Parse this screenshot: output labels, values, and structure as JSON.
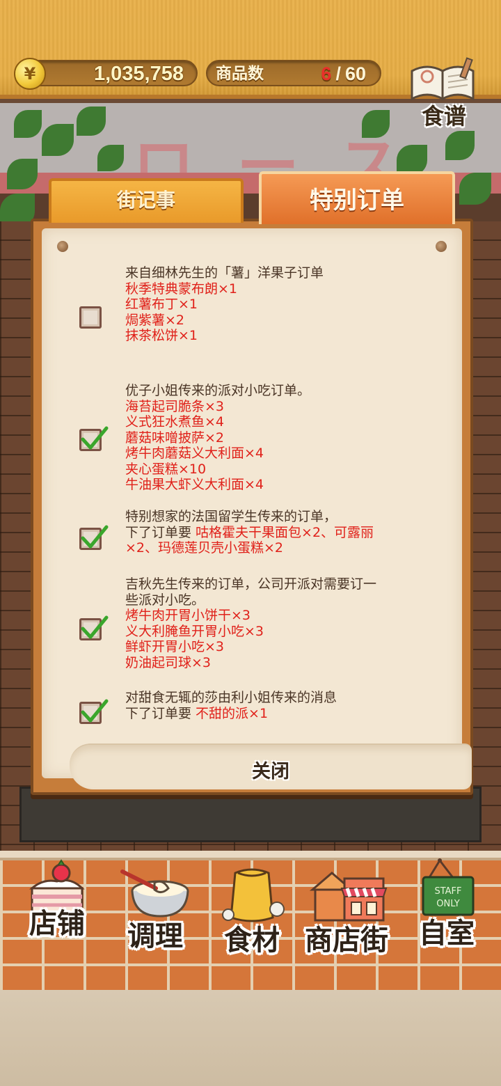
{
  "header": {
    "money": "1,035,758",
    "currency_symbol": "¥",
    "goods_label": "商品数",
    "goods_current": "6",
    "goods_separator": "/",
    "goods_max": "60",
    "recipe_label": "食谱"
  },
  "tabs": {
    "street_news": "街记事",
    "special_orders": "特别订单",
    "active": "special_orders"
  },
  "orders": [
    {
      "checked": false,
      "desc": "来自细林先生的「薯」洋果子订单",
      "items": [
        "秋季特典蒙布朗×1",
        "红薯布丁×1",
        "焗紫薯×2",
        "抹茶松饼×1"
      ]
    },
    {
      "checked": true,
      "desc": "优子小姐传来的派对小吃订单。",
      "items": [
        "海苔起司脆条×3",
        "义式狂水煮鱼×4",
        "蘑菇味噌披萨×2",
        "烤牛肉蘑菇义大利面×4",
        "夹心蛋糕×10",
        "牛油果大虾义大利面×4"
      ]
    },
    {
      "checked": true,
      "desc": "特别想家的法国留学生传来的订单，",
      "line2_prefix": "下了订单要 ",
      "line2_red": "咕格霍夫干果面包×2、可露丽",
      "line3_red": "×2、玛德莲贝壳小蛋糕×2"
    },
    {
      "checked": true,
      "desc": "吉秋先生传来的订单，公司开派对需要订一",
      "desc2": "些派对小吃。",
      "items": [
        "烤牛肉开胃小饼干×3",
        "义大利腌鱼开胃小吃×3",
        "鲜虾开胃小吃×3",
        "奶油起司球×3"
      ]
    },
    {
      "checked": true,
      "desc": "对甜食无辄的莎由利小姐传来的消息",
      "line2_prefix": "下了订单要 ",
      "line2_red": "不甜的派×1"
    }
  ],
  "close_label": "关闭",
  "nav": {
    "shop": "店铺",
    "cook": "调理",
    "ingredients": "食材",
    "street": "商店街",
    "room": "自室",
    "staff_sign_line1": "STAFF",
    "staff_sign_line2": "ONLY"
  },
  "colors": {
    "order_item_red": "#e0211a",
    "topbar": "#e6ad45",
    "tab_active": "#e0702a"
  }
}
